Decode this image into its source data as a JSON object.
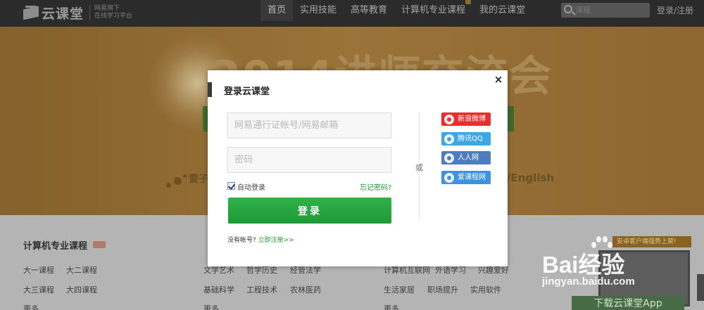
{
  "brand": {
    "name": "云课堂",
    "tagline_1": "网易旗下",
    "tagline_2": "在线学习平台"
  },
  "nav": {
    "items": [
      {
        "label": "首页"
      },
      {
        "label": "实用技能"
      },
      {
        "label": "高等教育"
      },
      {
        "label": "计算机专业课程"
      },
      {
        "label": "我的云课堂"
      }
    ],
    "active_index": 0,
    "search_placeholder": "课程",
    "login_register": "登录/注册"
  },
  "banner": {
    "title": "2014讲师交流会",
    "left_text": "雷子",
    "right_text": "/English"
  },
  "categories": {
    "section_title": "计算机专业课程",
    "col1": [
      "大一课程",
      "大二课程",
      "大三课程",
      "大四课程",
      "更多"
    ],
    "col2": [
      "文学艺术",
      "哲学历史",
      "经管法学",
      "基础科学",
      "工程技术",
      "农林医药",
      "更多"
    ],
    "col3": [
      "计算机互联网",
      "外语学习",
      "兴趣爱好",
      "生活家居",
      "职场提升",
      "实用软件",
      "更多"
    ]
  },
  "app_promo": {
    "badge": "安卓客户端强势上架!",
    "download": "下载云课堂App"
  },
  "watermark": {
    "main": "Bai经验",
    "sub": "jingyan.baidu.com"
  },
  "login_modal": {
    "title": "登录云课堂",
    "close": "×",
    "account_placeholder": "网易通行证帐号/网易邮箱",
    "password_placeholder": "密码",
    "auto_login": "自动登录",
    "auto_login_checked": true,
    "forgot": "忘记密码?",
    "submit": "登录",
    "no_account": "没有帐号?",
    "register_now": "立即注册>>",
    "or": "或",
    "social": [
      {
        "label": "新浪微博",
        "color": "#e5302f"
      },
      {
        "label": "腾讯QQ",
        "color": "#3fa6e6"
      },
      {
        "label": "人人网",
        "color": "#4e7cc0"
      },
      {
        "label": "爱课程网",
        "color": "#3d93e0"
      }
    ]
  },
  "colors": {
    "accent_green": "#21a03c",
    "topbar": "#2b2b2b"
  }
}
